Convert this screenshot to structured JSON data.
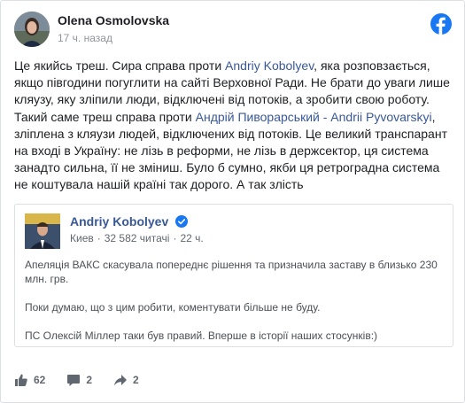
{
  "header": {
    "author": "Olena Osmolovska",
    "time": "17 ч. назад"
  },
  "post": {
    "p1": "Це якийсь треш. Сира справа проти ",
    "link1": "Andriy Kobolyev",
    "p2": ", яка розповзається, якщо півгодини погуглити на сайті Верховної Ради. Не брати до уваги лише кляузу, яку зліпили люди, відключені від потоків, а зробити свою роботу. Такий самe треш справа проти ",
    "link2": "Андрій Пиворарський - Andrii Pyvovarskyi",
    "p3": ", зліплена з кляузи людей, відключених від потоків. Це великий транспарант на вході в Україну: не лізь в реформи, не лізь в держсектор, ця система занадто сильна, її не зміниш. Було б сумно, якби ця ретроградна система не коштувала нашій країні так дорого. А так злість"
  },
  "embed": {
    "author": "Andriy Kobolyev",
    "location": "Киев",
    "readers": "32 582 читачі",
    "time": "22 ч.",
    "body": [
      "Апеляція ВАКС скасувала попереднє рішення та призначила заставу в близько 230 млн. грв.",
      "Поки думаю, що з цим робити, коментувати більше не буду.",
      "ПС Олексій Міллер таки був правий. Вперше в історії наших стосунків:)"
    ]
  },
  "footer": {
    "likes": "62",
    "comments": "2",
    "shares": "2"
  },
  "colors": {
    "link": "#385898",
    "facebook": "#1877f2"
  }
}
